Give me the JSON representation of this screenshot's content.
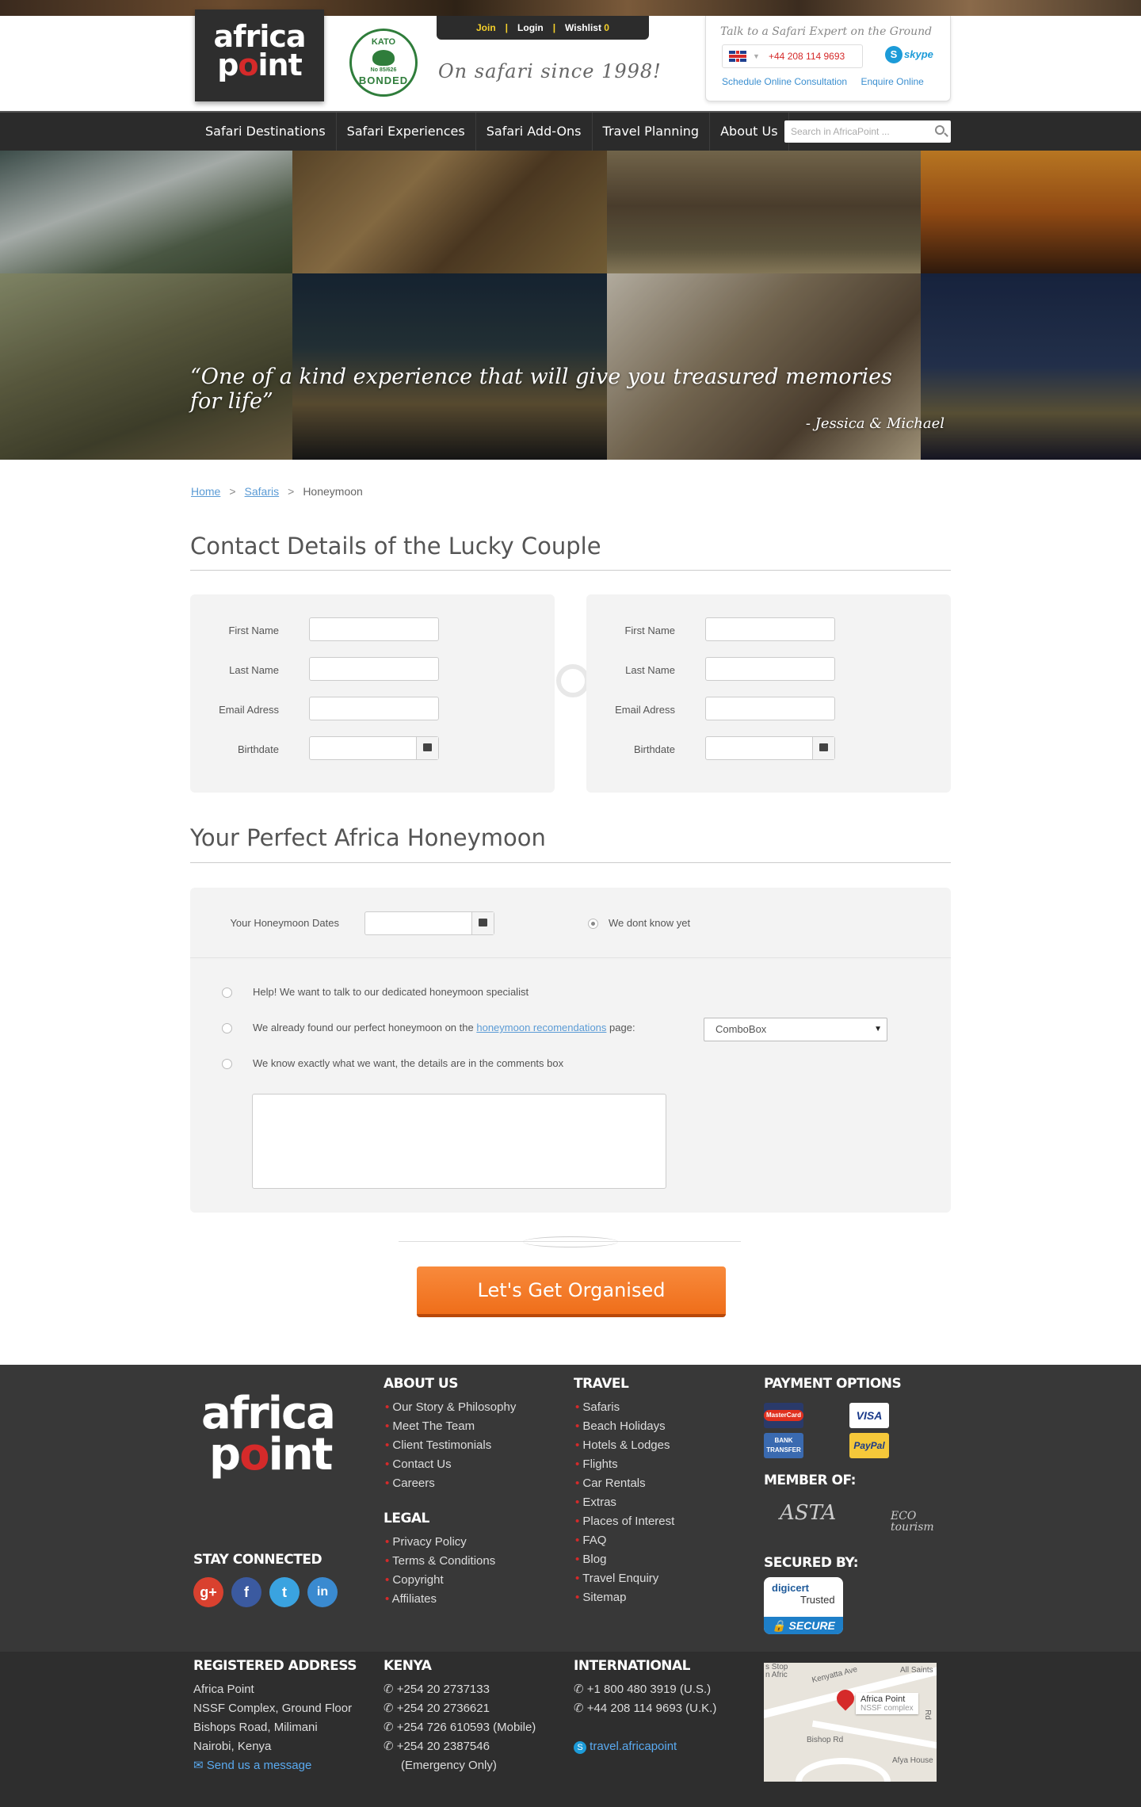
{
  "header": {
    "logo_line1": "africa",
    "logo_line2_a": "p",
    "logo_line2_o": "o",
    "logo_line2_b": "int",
    "kato_top": "KATO",
    "kato_number": "No 85/626",
    "kato_bottom": "BONDED",
    "tagline": "On safari since 1998!",
    "account": {
      "join": "Join",
      "login": "Login",
      "wishlist": "Wishlist",
      "wishlist_count": "0",
      "sep": "|"
    },
    "expert": {
      "title": "Talk to a Safari Expert on the Ground",
      "phone": "+44 208 114 9693",
      "skype": "skype",
      "schedule": "Schedule Online Consultation",
      "enquire": "Enquire Online"
    }
  },
  "nav": {
    "items": [
      "Safari Destinations",
      "Safari Experiences",
      "Safari Add-Ons",
      "Travel Planning",
      "About Us"
    ],
    "search_placeholder": "Search in AfricaPoint ..."
  },
  "hero": {
    "quote": "“One of a kind experience that will give you treasured memories for life”",
    "author": "- Jessica & Michael"
  },
  "breadcrumb": {
    "home": "Home",
    "safaris": "Safaris",
    "current": "Honeymoon",
    "sep": ">"
  },
  "contact": {
    "heading": "Contact Details of the Lucky Couple",
    "labels": {
      "first_name": "First Name",
      "last_name": "Last Name",
      "email": "Email Adress",
      "birthdate": "Birthdate"
    }
  },
  "honeymoon": {
    "heading": "Your Perfect Africa Honeymoon",
    "dates_label": "Your Honeymoon Dates",
    "dont_know": "We dont know yet",
    "opt_help": "Help! We want to talk to our dedicated honeymoon specialist",
    "opt_found_a": "We already found our perfect honeymoon on the",
    "opt_found_link": "honeymoon recomendations",
    "opt_found_b": "page:",
    "combo_value": "ComboBox",
    "opt_exact": "We know exactly what we want, the details are in the comments box"
  },
  "cta": {
    "label": "Let's Get Organised"
  },
  "footer": {
    "logo_line1": "africa",
    "logo_line2_a": "p",
    "logo_line2_o": "o",
    "logo_line2_b": "int",
    "about": {
      "heading": "About Us",
      "items": [
        "Our Story & Philosophy",
        "Meet The Team",
        "Client Testimonials",
        "Contact Us",
        "Careers"
      ]
    },
    "legal": {
      "heading": "Legal",
      "items": [
        "Privacy Policy",
        "Terms & Conditions",
        "Copyright",
        "Affiliates"
      ]
    },
    "travel": {
      "heading": "Travel",
      "items": [
        "Safaris",
        "Beach Holidays",
        "Hotels & Lodges",
        "Flights",
        "Car Rentals",
        "Extras",
        "Places of Interest",
        "FAQ",
        "Blog",
        "Travel Enquiry",
        "Sitemap"
      ]
    },
    "payment": {
      "heading": "Payment Options",
      "mastercard": "MasterCard",
      "visa": "VISA",
      "bank": "BANK TRANSFER",
      "paypal": "PayPal"
    },
    "member": {
      "heading": "Member Of:",
      "asta": "ASTA",
      "eco": "ECO tourism"
    },
    "secured": {
      "heading": "Secured By:",
      "digicert": "digicert",
      "trusted": "Trusted",
      "secure": "SECURE"
    },
    "stay_connected": "Stay Connected",
    "social": {
      "gplus": "g+",
      "facebook": "f",
      "twitter": "t",
      "linkedin": "in"
    },
    "registered": {
      "heading": "Registered Address",
      "lines": [
        "Africa Point",
        "NSSF Complex, Ground Floor",
        "Bishops Road, Milimani",
        "Nairobi, Kenya"
      ],
      "message": "Send us a message"
    },
    "kenya": {
      "heading": "Kenya",
      "phones": [
        "+254 20 2737133",
        "+254 20 2736621",
        "+254 726 610593 (Mobile)",
        "+254 20 2387546"
      ],
      "emergency": "(Emergency Only)"
    },
    "international": {
      "heading": "International",
      "phones": [
        "+1 800 480 3919 (U.S.)",
        "+44 208 114 9693 (U.K.)"
      ],
      "skype": "travel.africapoint"
    },
    "map": {
      "place": "Africa Point",
      "sub": "NSSF complex",
      "road1": "Kenyatta Ave",
      "road2": "Bishop Rd",
      "saints": "All Saints",
      "stop": "s Stop",
      "afric": "n Afric",
      "house": "Afya House",
      "rd": "Rd"
    }
  },
  "colors": {
    "accent": "#ef6e1a",
    "brand_red": "#d52a2a",
    "link": "#5b9bd5",
    "dark": "#2b2b2b"
  }
}
